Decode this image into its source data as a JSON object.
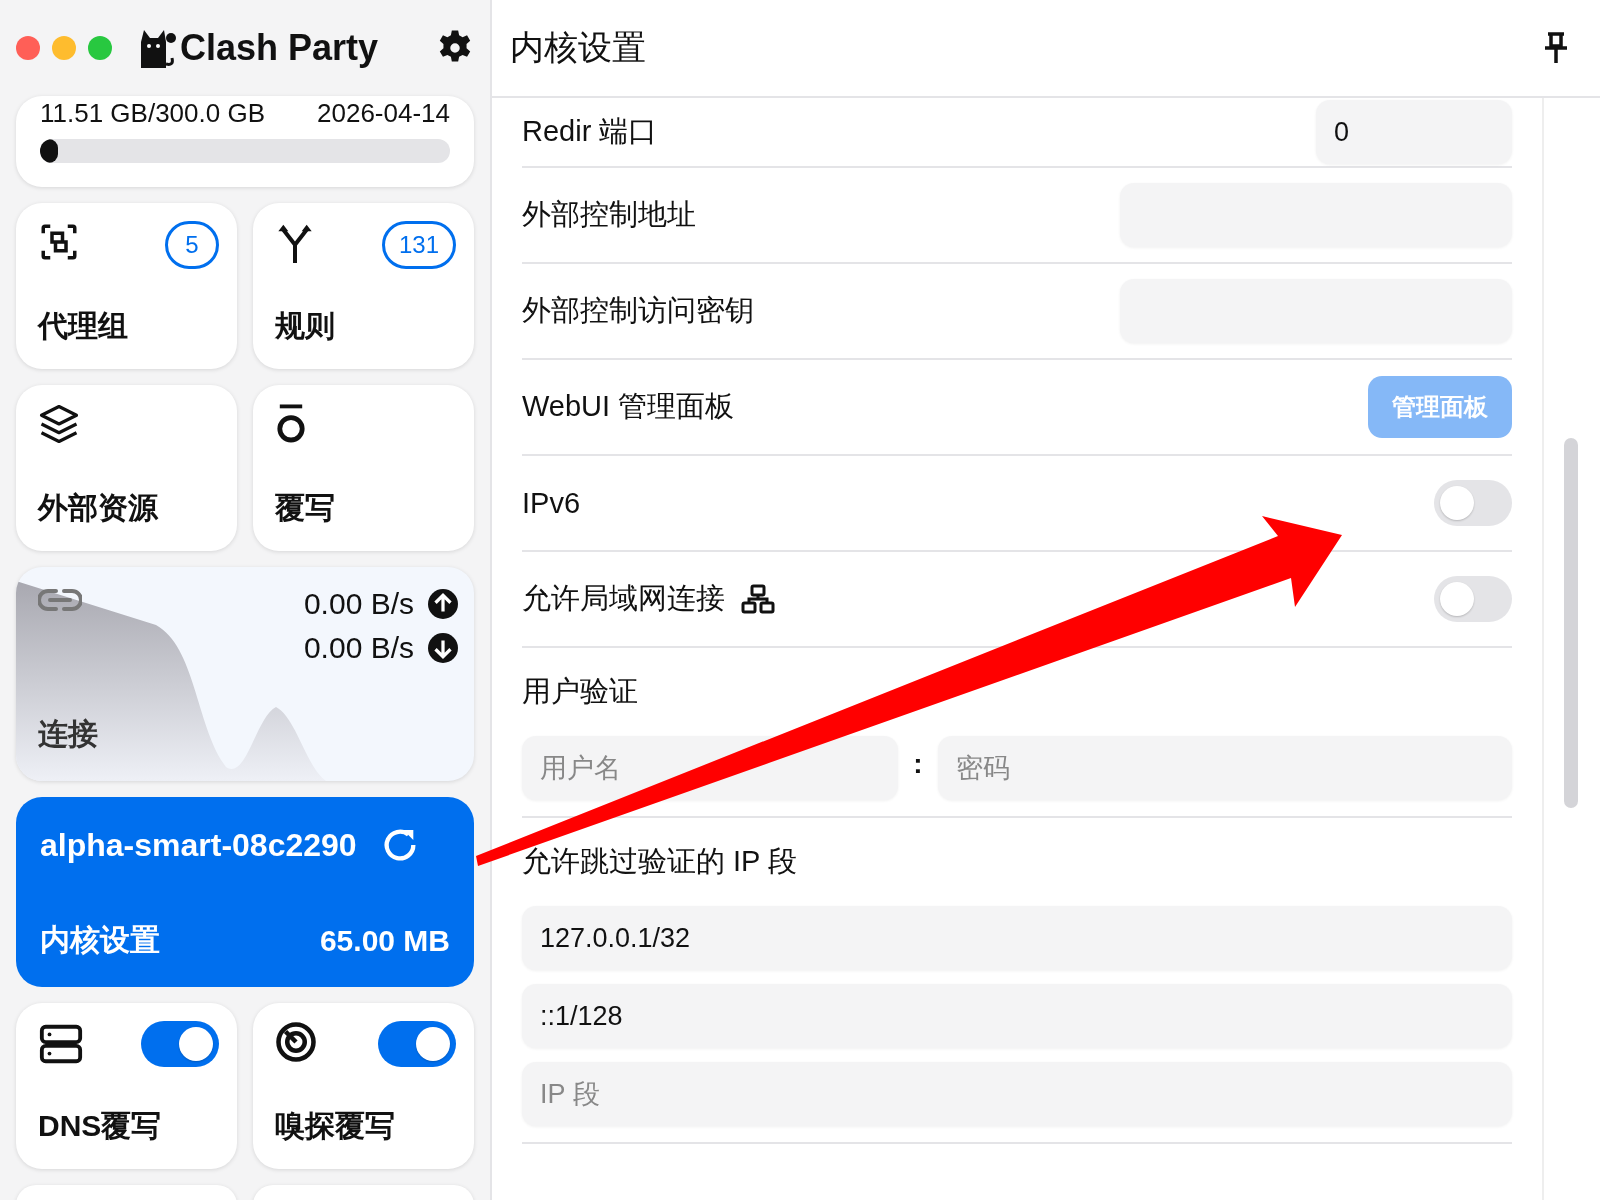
{
  "window": {
    "title": "Clash Party"
  },
  "traffic": {
    "used": "11.51 GB/300.0 GB",
    "expire": "2026-04-14",
    "level": 0.01
  },
  "tiles": [
    {
      "kind": "proxies",
      "label": "代理组",
      "badge": "5"
    },
    {
      "kind": "rules",
      "label": "规则",
      "badge": "131"
    },
    {
      "kind": "resources",
      "label": "外部资源"
    },
    {
      "kind": "override",
      "label": "覆写"
    }
  ],
  "connections": {
    "label": "连接",
    "upload": "0.00 B/s",
    "download": "0.00 B/s"
  },
  "profile": {
    "name": "alpha-smart-08c2290",
    "page": "内核设置",
    "memory": "65.00 MB",
    "selected": true
  },
  "toggle_tiles": [
    {
      "kind": "dns",
      "label": "DNS覆写",
      "on": true
    },
    {
      "kind": "sniff",
      "label": "嗅探覆写",
      "on": true
    }
  ],
  "panel": {
    "title": "内核设置",
    "rows": [
      {
        "kind": "input",
        "label": "Redir 端口",
        "value": "0",
        "short": true
      },
      {
        "kind": "input",
        "label": "外部控制地址"
      },
      {
        "kind": "input",
        "label": "外部控制访问密钥"
      },
      {
        "kind": "button",
        "label": "WebUI 管理面板",
        "button": "管理面板",
        "disabled": true
      },
      {
        "kind": "switch",
        "label": "IPv6",
        "on": false
      },
      {
        "kind": "switch",
        "label": "允许局域网连接",
        "on": false,
        "network_icon": true
      }
    ],
    "auth": {
      "label": "用户验证",
      "username_placeholder": "用户名",
      "separator": ":",
      "password_placeholder": "密码"
    },
    "skip_auth": {
      "label": "允许跳过验证的 IP 段",
      "entries": [
        "127.0.0.1/32",
        "::1/128"
      ],
      "placeholder": "IP 段"
    }
  }
}
